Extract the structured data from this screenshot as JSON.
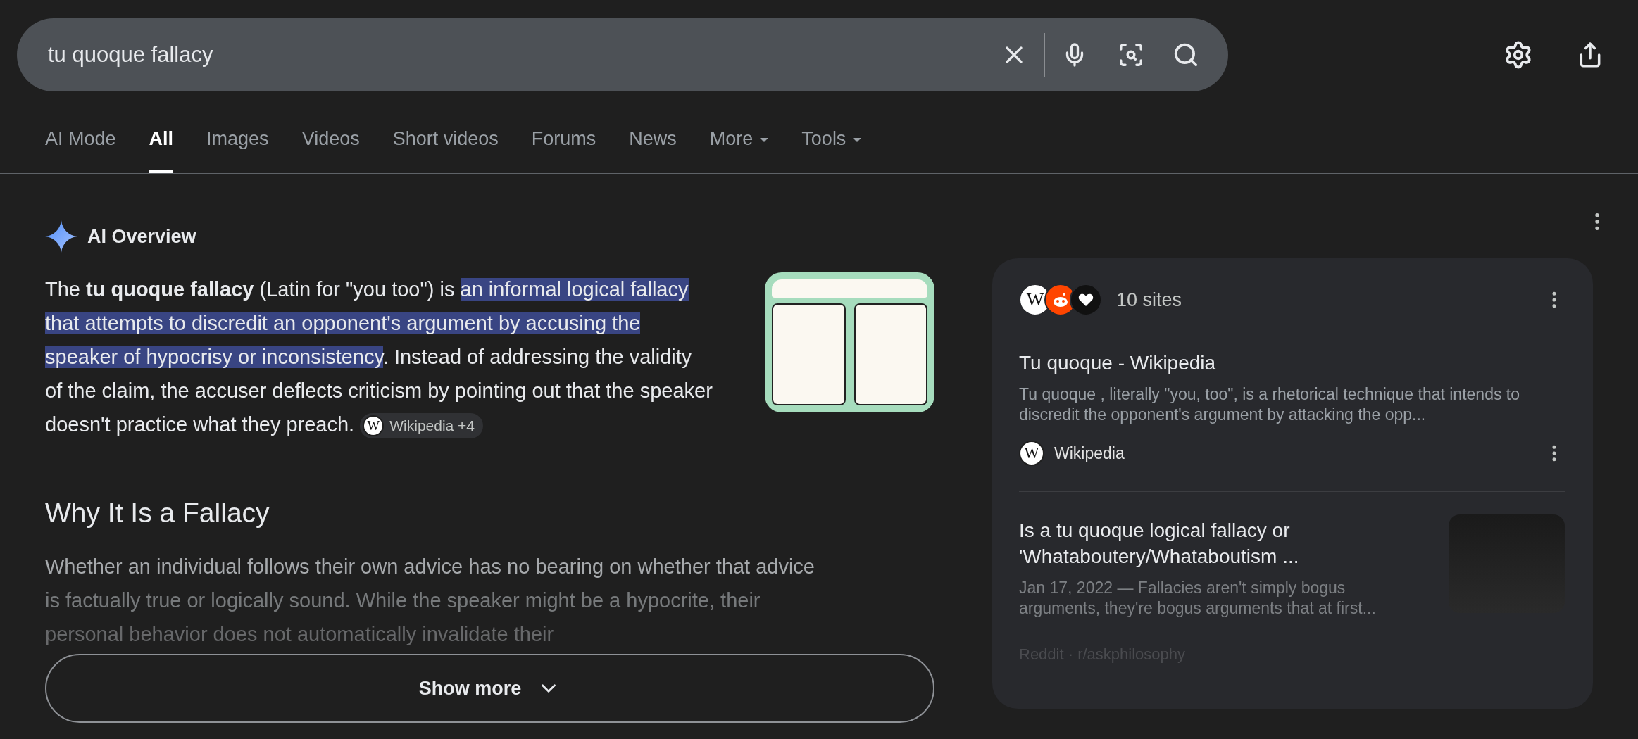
{
  "search": {
    "value": "tu quoque fallacy"
  },
  "tabs": [
    {
      "label": "AI Mode",
      "selected": false,
      "has_menu": false
    },
    {
      "label": "All",
      "selected": true,
      "has_menu": false
    },
    {
      "label": "Images",
      "selected": false,
      "has_menu": false
    },
    {
      "label": "Videos",
      "selected": false,
      "has_menu": false
    },
    {
      "label": "Short videos",
      "selected": false,
      "has_menu": false
    },
    {
      "label": "Forums",
      "selected": false,
      "has_menu": false
    },
    {
      "label": "News",
      "selected": false,
      "has_menu": false
    },
    {
      "label": "More",
      "selected": false,
      "has_menu": true
    },
    {
      "label": "Tools",
      "selected": false,
      "has_menu": true
    }
  ],
  "ai_overview": {
    "title": "AI Overview",
    "intro": [
      {
        "text": "The **tu quoque fallacy** (Latin for \"you too\") is ",
        "highlighted": false
      },
      {
        "text": "an informal logical fallacy that attempts to discredit an opponent's argument by accusing the speaker of hypocrisy or inconsistency",
        "highlighted": true
      },
      {
        "text": ". Instead of addressing the validity of the claim, the accuser deflects criticism by pointing out that the speaker doesn't practice what they preach. ",
        "highlighted": false
      }
    ],
    "citation": {
      "icon_letter": "W",
      "label": "Wikipedia +4"
    },
    "heading": "Why It Is a Fallacy",
    "faded_lines": [
      "Whether an individual follows their own advice has no bearing on whether that advice",
      "is factually true or logically sound. While the speaker might be a hypocrite, their",
      "personal behavior does not automatically invalidate their"
    ],
    "show_more": "Show more"
  },
  "sources": {
    "site_icons": [
      {
        "kind": "letter",
        "label": "W"
      },
      {
        "kind": "reddit"
      },
      {
        "kind": "heart"
      }
    ],
    "count_label": "10 sites",
    "results": [
      {
        "title": "Tu quoque - Wikipedia",
        "snippet": "Tu quoque , literally \"you, too\", is a rhetorical technique that intends to discredit the opponent's argument by attacking the opp...",
        "source_letter": "W",
        "source": "Wikipedia",
        "has_thumbnail": false
      },
      {
        "title": "Is a tu quoque logical fallacy or 'Whataboutery/Whataboutism ...",
        "snippet": "Jan 17, 2022 — Fallacies aren't simply bogus arguments, they're bogus arguments that at first...",
        "has_thumbnail": true
      }
    ],
    "faded_source": "Reddit · r/askphilosophy"
  }
}
